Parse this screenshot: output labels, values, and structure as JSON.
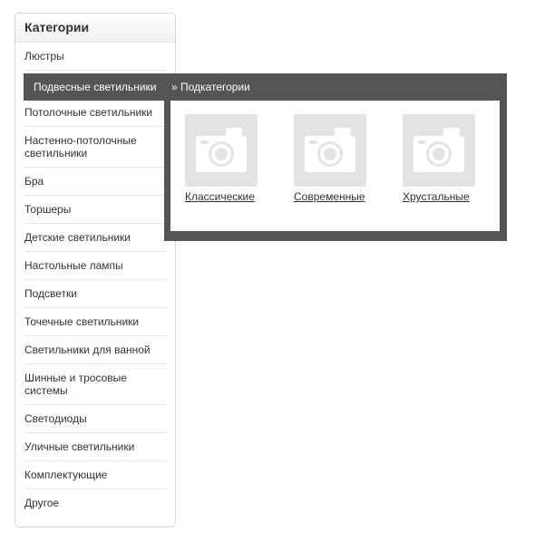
{
  "sidebar": {
    "title": "Категории",
    "items": [
      {
        "label": "Люстры"
      },
      {
        "label": "Подвесные светильники"
      },
      {
        "label": "Потолочные светильники"
      },
      {
        "label": "Настенно-потолочные светильники"
      },
      {
        "label": "Бра"
      },
      {
        "label": "Торшеры"
      },
      {
        "label": "Детские светильники"
      },
      {
        "label": "Настольные лампы"
      },
      {
        "label": "Подсветки"
      },
      {
        "label": "Точечные светильники"
      },
      {
        "label": "Светильники для ванной"
      },
      {
        "label": "Шинные и тросовые системы"
      },
      {
        "label": "Светодиоды"
      },
      {
        "label": "Уличные светильники"
      },
      {
        "label": "Комплектующие"
      },
      {
        "label": "Другое"
      }
    ]
  },
  "flyout": {
    "title": "» Подкатегории",
    "subcategories": [
      {
        "label": "Классические",
        "icon": "camera-placeholder-icon"
      },
      {
        "label": "Современные",
        "icon": "camera-placeholder-icon"
      },
      {
        "label": "Хрустальные",
        "icon": "camera-placeholder-icon"
      }
    ]
  },
  "colors": {
    "active_bg": "#555555",
    "placeholder_bg": "#e3e3e3"
  }
}
